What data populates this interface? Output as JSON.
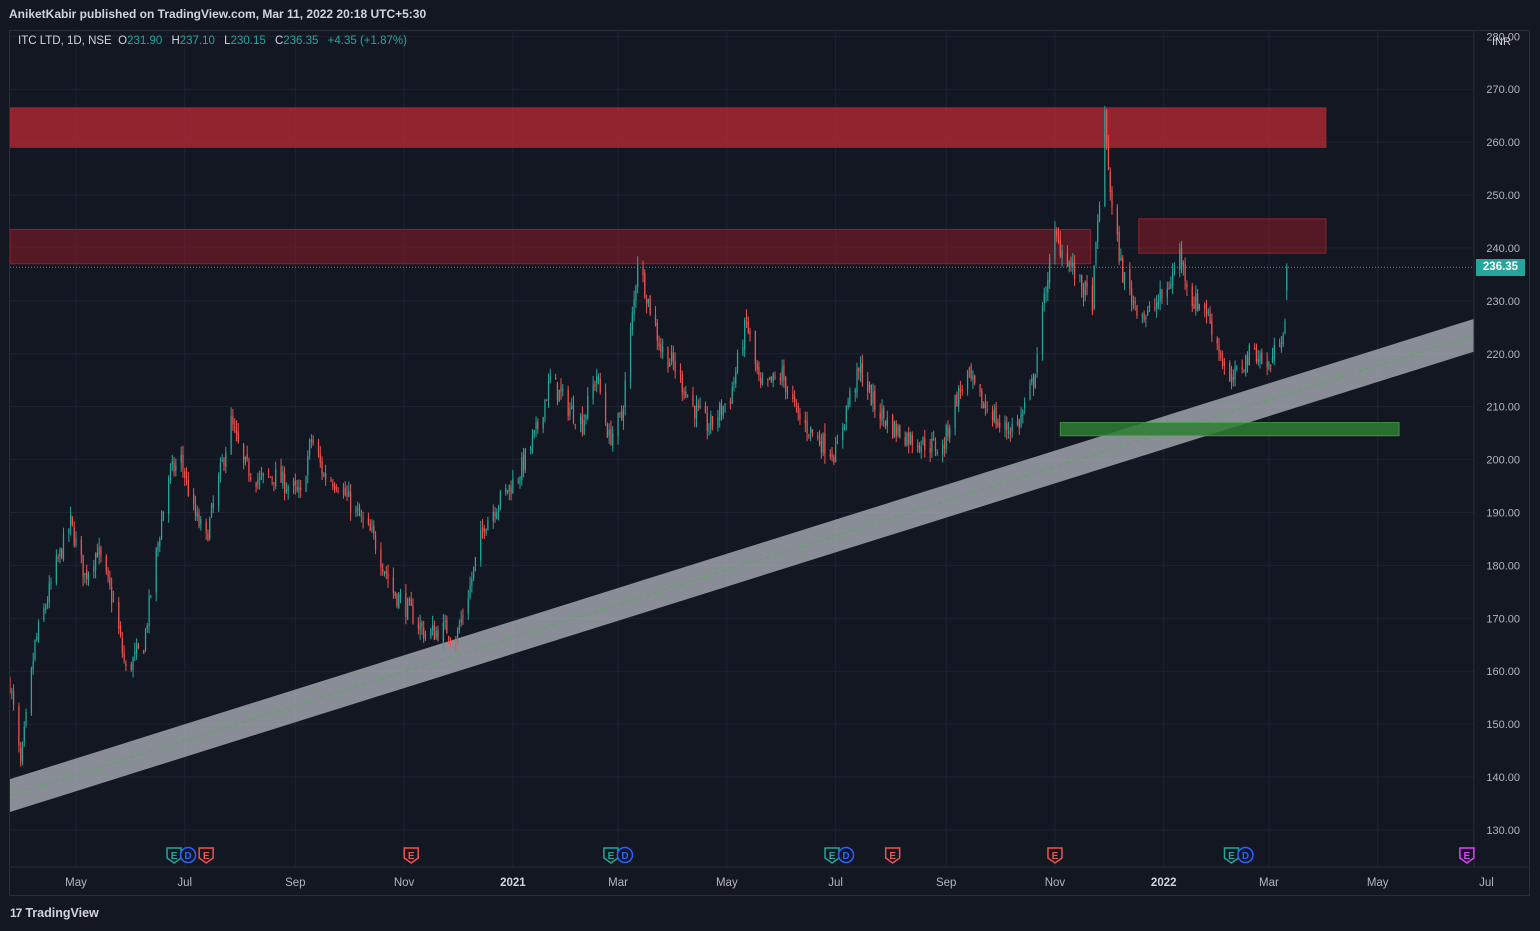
{
  "header": {
    "publisher": "AniketKabir published on TradingView.com, Mar 11, 2022 20:18 UTC+5:30"
  },
  "legend": {
    "symbol": "ITC LTD, 1D, NSE",
    "o_label": "O",
    "o": "231.90",
    "h_label": "H",
    "h": "237.10",
    "l_label": "L",
    "l": "230.15",
    "c_label": "C",
    "c": "236.35",
    "change": "+4.35 (+1.87%)"
  },
  "currency": "INR",
  "last_price": "236.35",
  "footer": {
    "brand_logo": "17",
    "brand": "TradingView"
  },
  "colors": {
    "up": "#26a69a",
    "down": "#ef5350",
    "background": "#131722"
  },
  "chart_data": {
    "type": "candlestick",
    "symbol": "ITC LTD",
    "interval": "1D",
    "exchange": "NSE",
    "currency": "INR",
    "ylim": [
      123,
      281
    ],
    "y_ticks": [
      130,
      140,
      150,
      160,
      170,
      180,
      190,
      200,
      210,
      220,
      230,
      240,
      250,
      260,
      270,
      280
    ],
    "y_tick_labels": [
      "130.00",
      "140.00",
      "150.00",
      "160.00",
      "170.00",
      "180.00",
      "190.00",
      "200.00",
      "210.00",
      "220.00",
      "230.00",
      "240.00",
      "250.00",
      "260.00",
      "270.00",
      "280.00"
    ],
    "xlim": [
      "2020-03-25",
      "2022-06-24"
    ],
    "x_ticks": [
      {
        "date": "2020-05-01",
        "label": "May"
      },
      {
        "date": "2020-07-01",
        "label": "Jul"
      },
      {
        "date": "2020-09-01",
        "label": "Sep"
      },
      {
        "date": "2020-11-01",
        "label": "Nov"
      },
      {
        "date": "2021-01-01",
        "label": "2021",
        "bold": true
      },
      {
        "date": "2021-03-01",
        "label": "Mar"
      },
      {
        "date": "2021-05-01",
        "label": "May"
      },
      {
        "date": "2021-07-01",
        "label": "Jul"
      },
      {
        "date": "2021-09-01",
        "label": "Sep"
      },
      {
        "date": "2021-11-01",
        "label": "Nov"
      },
      {
        "date": "2022-01-01",
        "label": "2022",
        "bold": true
      },
      {
        "date": "2022-03-01",
        "label": "Mar"
      },
      {
        "date": "2022-05-01",
        "label": "May"
      },
      {
        "date": "2022-07-01",
        "label": "Jul"
      }
    ],
    "grid": true,
    "path_points": [
      [
        "2020-03-25",
        158
      ],
      [
        "2020-03-31",
        142
      ],
      [
        "2020-04-08",
        165
      ],
      [
        "2020-04-20",
        180
      ],
      [
        "2020-04-28",
        188
      ],
      [
        "2020-05-06",
        178
      ],
      [
        "2020-05-13",
        183
      ],
      [
        "2020-05-22",
        173
      ],
      [
        "2020-05-29",
        160
      ],
      [
        "2020-06-08",
        165
      ],
      [
        "2020-06-15",
        182
      ],
      [
        "2020-06-22",
        197
      ],
      [
        "2020-06-29",
        200
      ],
      [
        "2020-07-06",
        190
      ],
      [
        "2020-07-13",
        185
      ],
      [
        "2020-07-20",
        196
      ],
      [
        "2020-07-27",
        207
      ],
      [
        "2020-08-03",
        199
      ],
      [
        "2020-08-12",
        196
      ],
      [
        "2020-08-20",
        197
      ],
      [
        "2020-08-28",
        195
      ],
      [
        "2020-09-04",
        193
      ],
      [
        "2020-09-10",
        204
      ],
      [
        "2020-09-17",
        197
      ],
      [
        "2020-09-24",
        196
      ],
      [
        "2020-10-05",
        190
      ],
      [
        "2020-10-15",
        185
      ],
      [
        "2020-10-26",
        175
      ],
      [
        "2020-11-05",
        171
      ],
      [
        "2020-11-13",
        167
      ],
      [
        "2020-11-25",
        168
      ],
      [
        "2020-11-30",
        166
      ],
      [
        "2020-12-08",
        176
      ],
      [
        "2020-12-16",
        188
      ],
      [
        "2020-12-24",
        192
      ],
      [
        "2021-01-04",
        197
      ],
      [
        "2021-01-14",
        205
      ],
      [
        "2021-01-22",
        215
      ],
      [
        "2021-02-01",
        210
      ],
      [
        "2021-02-09",
        207
      ],
      [
        "2021-02-17",
        216
      ],
      [
        "2021-02-24",
        204
      ],
      [
        "2021-03-03",
        208
      ],
      [
        "2021-03-10",
        230
      ],
      [
        "2021-03-12",
        238
      ],
      [
        "2021-03-18",
        230
      ],
      [
        "2021-03-25",
        221
      ],
      [
        "2021-04-01",
        218
      ],
      [
        "2021-04-12",
        210
      ],
      [
        "2021-04-21",
        206
      ],
      [
        "2021-05-03",
        212
      ],
      [
        "2021-05-12",
        226
      ],
      [
        "2021-05-20",
        213
      ],
      [
        "2021-06-01",
        216
      ],
      [
        "2021-06-10",
        208
      ],
      [
        "2021-06-21",
        204
      ],
      [
        "2021-07-01",
        201
      ],
      [
        "2021-07-08",
        211
      ],
      [
        "2021-07-15",
        217
      ],
      [
        "2021-07-23",
        210
      ],
      [
        "2021-08-02",
        206
      ],
      [
        "2021-08-12",
        204
      ],
      [
        "2021-08-20",
        203
      ],
      [
        "2021-08-30",
        202
      ],
      [
        "2021-09-06",
        211
      ],
      [
        "2021-09-13",
        216
      ],
      [
        "2021-09-20",
        211
      ],
      [
        "2021-09-27",
        209
      ],
      [
        "2021-10-01",
        206
      ],
      [
        "2021-10-06",
        206
      ],
      [
        "2021-10-12",
        207
      ],
      [
        "2021-10-20",
        215
      ],
      [
        "2021-10-28",
        235
      ],
      [
        "2021-11-01",
        242
      ],
      [
        "2021-11-08",
        238
      ],
      [
        "2021-11-15",
        233
      ],
      [
        "2021-11-22",
        230
      ],
      [
        "2021-11-29",
        264
      ],
      [
        "2021-12-03",
        247
      ],
      [
        "2021-12-09",
        235
      ],
      [
        "2021-12-15",
        230
      ],
      [
        "2021-12-22",
        227
      ],
      [
        "2022-01-03",
        232
      ],
      [
        "2022-01-10",
        239
      ],
      [
        "2022-01-17",
        230
      ],
      [
        "2022-01-24",
        229
      ],
      [
        "2022-01-31",
        222
      ],
      [
        "2022-02-07",
        214
      ],
      [
        "2022-02-14",
        218
      ],
      [
        "2022-02-21",
        221
      ],
      [
        "2022-02-28",
        217
      ],
      [
        "2022-03-04",
        220
      ],
      [
        "2022-03-10",
        226
      ],
      [
        "2022-03-11",
        236.35
      ]
    ],
    "zones": [
      {
        "type": "resistance",
        "from": "2020-03-25",
        "to": "2022-04-02",
        "low": 259,
        "high": 266.5
      },
      {
        "type": "resistance",
        "from": "2020-03-25",
        "to": "2021-11-21",
        "low": 237,
        "high": 243.5
      },
      {
        "type": "resistance",
        "from": "2021-12-18",
        "to": "2022-04-02",
        "low": 239,
        "high": 245.5
      },
      {
        "type": "support",
        "from": "2021-11-04",
        "to": "2022-05-13",
        "low": 204.5,
        "high": 207
      }
    ],
    "trend_channel": {
      "start": [
        "2020-03-25",
        136.5
      ],
      "end": [
        "2022-06-24",
        223.5
      ],
      "band_height": 6,
      "color": "#b2b5be"
    },
    "last_price_line": 236.35,
    "event_markers": [
      {
        "date": "2020-06-25",
        "labels": [
          "E",
          "D"
        ]
      },
      {
        "date": "2020-07-13",
        "labels": [
          "E"
        ]
      },
      {
        "date": "2020-11-05",
        "labels": [
          "E"
        ]
      },
      {
        "date": "2021-02-25",
        "labels": [
          "E",
          "D"
        ]
      },
      {
        "date": "2021-06-29",
        "labels": [
          "E",
          "D"
        ]
      },
      {
        "date": "2021-08-02",
        "labels": [
          "E"
        ]
      },
      {
        "date": "2021-11-01",
        "labels": [
          "E"
        ]
      },
      {
        "date": "2022-02-08",
        "labels": [
          "E",
          "D"
        ]
      },
      {
        "date": "2022-06-20",
        "labels": [
          "E"
        ]
      }
    ]
  }
}
